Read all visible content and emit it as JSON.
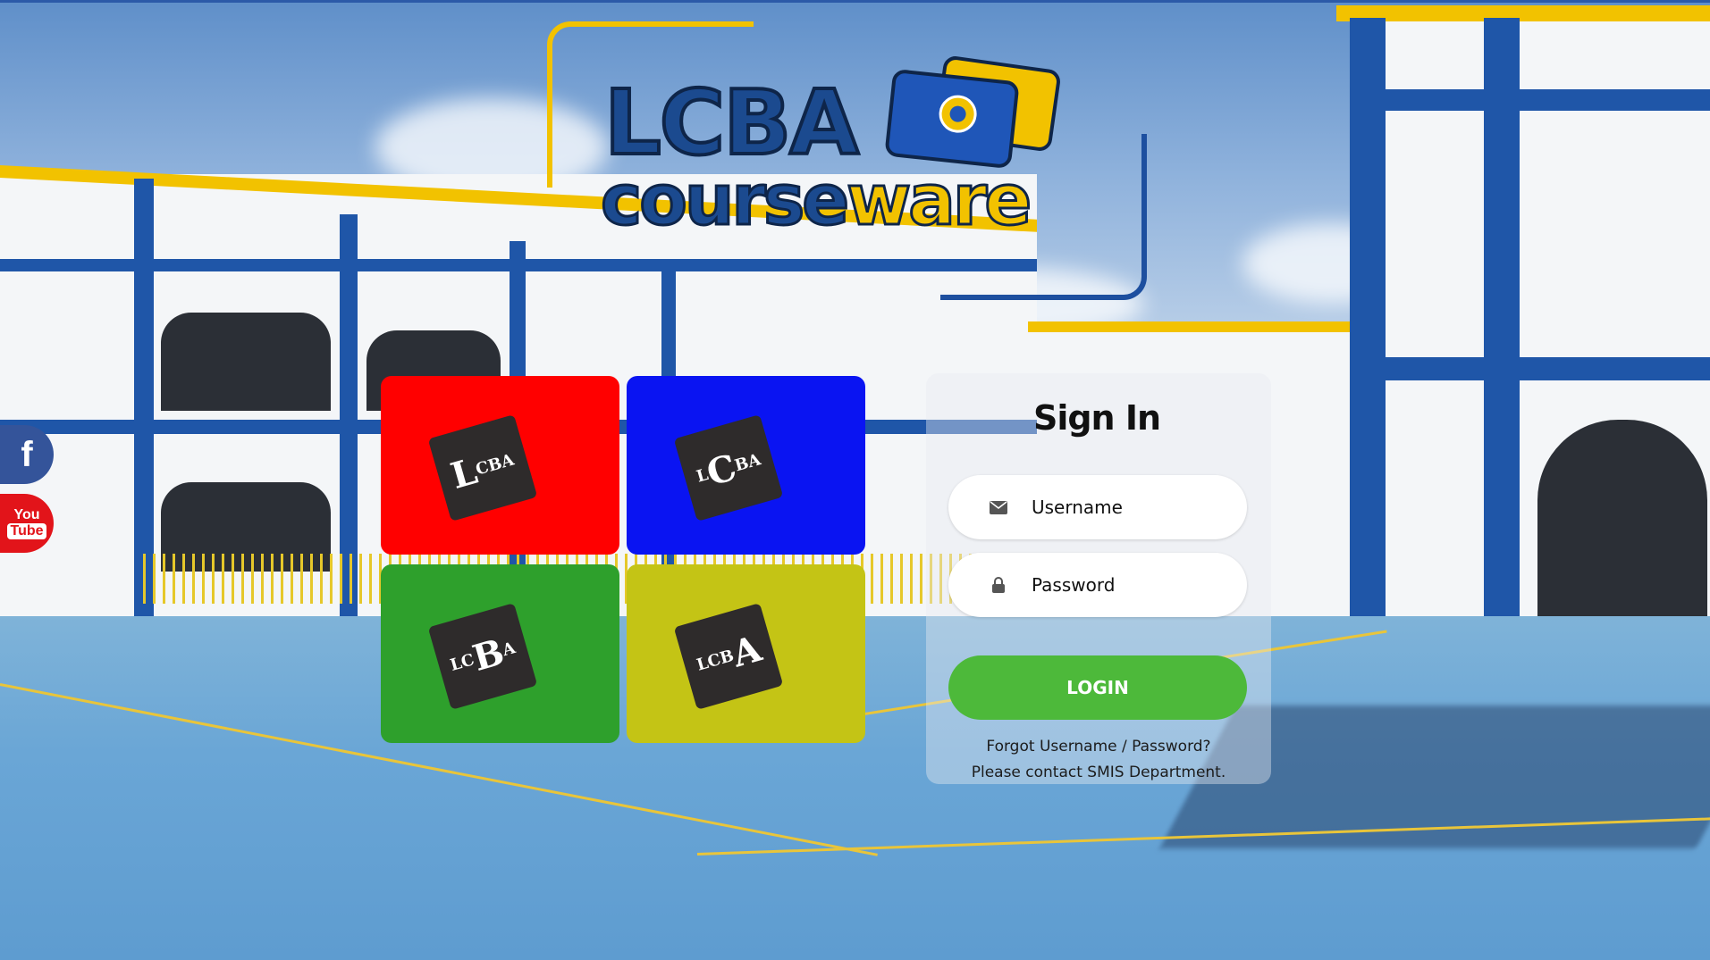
{
  "logo": {
    "line1": "LCBA",
    "line2_part1": "course",
    "line2_part2": "ware"
  },
  "social": {
    "facebook_glyph": "f",
    "youtube_you": "You",
    "youtube_tube": "Tube"
  },
  "tiles": [
    {
      "color": "#ff0000",
      "prefix": "",
      "big": "L",
      "suffix": "CBA"
    },
    {
      "color": "#0a14f2",
      "prefix": "L",
      "big": "C",
      "suffix": "BA"
    },
    {
      "color": "#2ea02c",
      "prefix": "LC",
      "big": "B",
      "suffix": "A"
    },
    {
      "color": "#c4c415",
      "prefix": "LCB",
      "big": "A",
      "suffix": ""
    }
  ],
  "signin": {
    "title": "Sign In",
    "username_placeholder": "Username",
    "password_placeholder": "Password",
    "login_label": "LOGIN",
    "help_line1": "Forgot Username / Password?",
    "help_line2": "Please contact SMIS Department."
  },
  "colors": {
    "brand_blue": "#1b4a8f",
    "brand_yellow": "#f2c200",
    "login_green": "#4db93a"
  }
}
